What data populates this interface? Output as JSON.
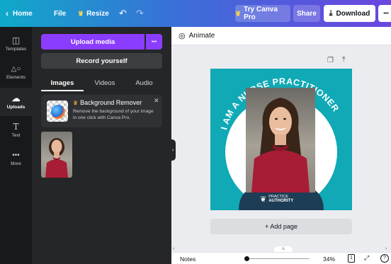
{
  "topbar": {
    "home_label": "Home",
    "file_label": "File",
    "resize_label": "Resize",
    "try_pro_label": "Try Canva Pro",
    "share_label": "Share",
    "download_label": "Download",
    "more_label": "•••"
  },
  "rail": {
    "items": [
      {
        "label": "Templates",
        "icon": "templates-icon"
      },
      {
        "label": "Elements",
        "icon": "elements-icon"
      },
      {
        "label": "Uploads",
        "icon": "uploads-icon"
      },
      {
        "label": "Text",
        "icon": "text-icon"
      },
      {
        "label": "More",
        "icon": "more-icon"
      }
    ]
  },
  "panel": {
    "upload_label": "Upload media",
    "upload_more": "•••",
    "record_label": "Record yourself",
    "tabs": [
      "Images",
      "Videos",
      "Audio"
    ],
    "bg_remover_title": "Background Remover",
    "bg_remover_desc": "Remove the background of your image in one click with Canva Pro."
  },
  "editor": {
    "animate_label": "Animate",
    "design_headline": "I AM A NURSE PRACTITIONER",
    "logo_line1": "PRACTICE",
    "logo_line2": "AUTHORITY",
    "add_page_label": "+ Add page",
    "notes_label": "Notes",
    "zoom_label": "34%",
    "page_count": "1",
    "zoom_level": 0.34
  },
  "colors": {
    "teal": "#10a9b5",
    "navy": "#1d3c55",
    "purple": "#8b3dff",
    "shirt": "#a81c35"
  }
}
